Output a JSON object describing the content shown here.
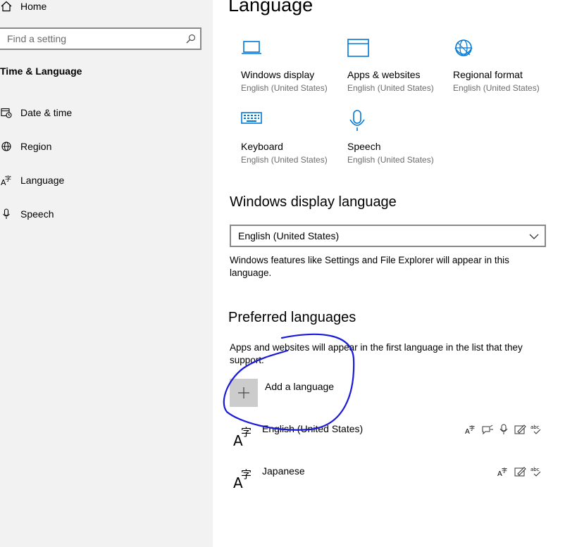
{
  "sidebar": {
    "home_label": "Home",
    "search_placeholder": "Find a setting",
    "section_title": "Time & Language",
    "items": [
      {
        "label": "Date & time",
        "icon": "calendar-clock-icon"
      },
      {
        "label": "Region",
        "icon": "globe-icon"
      },
      {
        "label": "Language",
        "icon": "language-icon"
      },
      {
        "label": "Speech",
        "icon": "microphone-icon"
      }
    ]
  },
  "main": {
    "title": "Language",
    "tiles": [
      {
        "name": "Windows display",
        "sub": "English (United States)",
        "icon": "laptop-icon"
      },
      {
        "name": "Apps & websites",
        "sub": "English (United States)",
        "icon": "window-icon"
      },
      {
        "name": "Regional format",
        "sub": "English (United States)",
        "icon": "globe-icon"
      },
      {
        "name": "Keyboard",
        "sub": "English (United States)",
        "icon": "keyboard-icon"
      },
      {
        "name": "Speech",
        "sub": "English (United States)",
        "icon": "microphone-icon"
      }
    ],
    "display_language": {
      "heading": "Windows display language",
      "selected": "English (United States)",
      "description": "Windows features like Settings and File Explorer will appear in this language."
    },
    "preferred": {
      "heading": "Preferred languages",
      "description": "Apps and websites will appear in the first language in the list that they support.",
      "add_label": "Add a language",
      "languages": [
        {
          "name": "English (United States)"
        },
        {
          "name": "Japanese"
        }
      ]
    }
  },
  "colors": {
    "accent": "#0078d7",
    "annotation": "#1a1adb",
    "sidebar_bg": "#f2f2f2"
  }
}
